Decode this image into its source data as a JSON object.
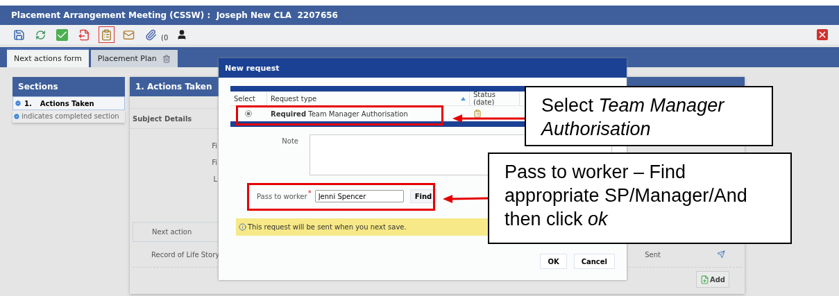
{
  "window": {
    "title": "Placement Arrangement Meeting (CSSW) :  Joseph New CLA  2207656"
  },
  "toolbar": {
    "attachment_count": "(0"
  },
  "tabs": [
    {
      "label": "Next actions form",
      "selected": true
    },
    {
      "label": "Placement Plan",
      "selected": false
    }
  ],
  "sections": {
    "title": "Sections",
    "items": [
      {
        "number": "1.",
        "label": "Actions Taken",
        "completed": true,
        "selected": true
      }
    ],
    "legend": "indicates completed section"
  },
  "form": {
    "title": "1. Actions Taken",
    "subject_label": "Subject Details",
    "field_labels": [
      "Fi",
      "Fi",
      "L"
    ],
    "next_action_label": "Next action",
    "rows": [
      {
        "label": "Record of Life Story",
        "status": "Sent"
      }
    ],
    "add_button": "Add"
  },
  "dialog": {
    "title": "New request",
    "table": {
      "columns": [
        "Select",
        "Request type",
        "Status (date)"
      ],
      "rows": [
        {
          "selected": true,
          "required_label": "Required",
          "request_type": "Team Manager Authorisation"
        }
      ]
    },
    "note_label": "Note",
    "worker_label": "Pass to worker",
    "required_mark": "*",
    "worker_value": "Jenni Spencer",
    "find_button": "Find",
    "info": "This request will be sent when you next save.",
    "buttons": [
      "OK",
      "Cancel"
    ]
  },
  "callouts": [
    {
      "text": "Select *Team Manager Authorisation*"
    },
    {
      "text": "Pass to worker – Find appropriate SP/Manager/And then click *ok*"
    }
  ]
}
